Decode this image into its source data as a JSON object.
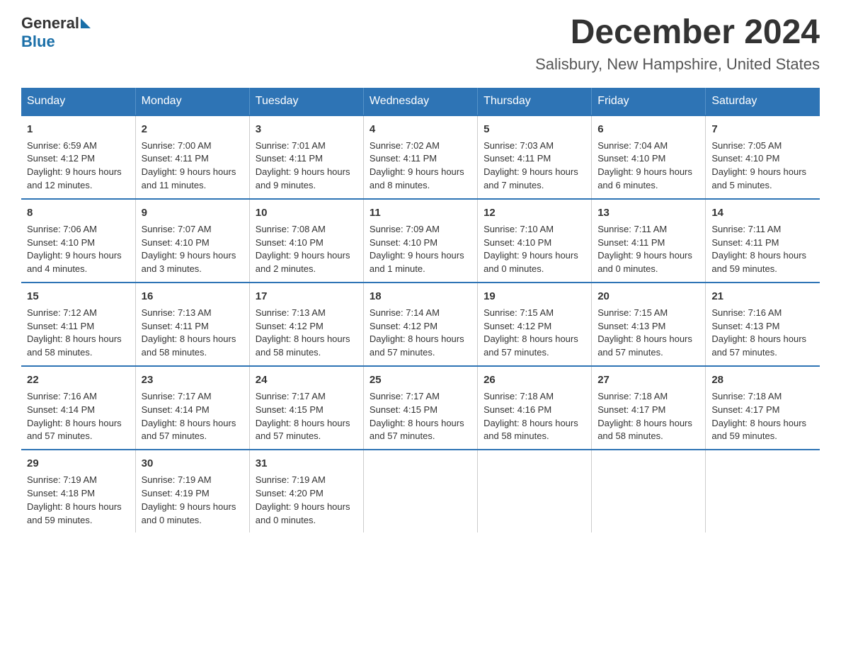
{
  "logo": {
    "general": "General",
    "blue": "Blue"
  },
  "title": "December 2024",
  "subtitle": "Salisbury, New Hampshire, United States",
  "weekdays": [
    "Sunday",
    "Monday",
    "Tuesday",
    "Wednesday",
    "Thursday",
    "Friday",
    "Saturday"
  ],
  "weeks": [
    [
      {
        "day": "1",
        "sunrise": "6:59 AM",
        "sunset": "4:12 PM",
        "daylight": "9 hours and 12 minutes."
      },
      {
        "day": "2",
        "sunrise": "7:00 AM",
        "sunset": "4:11 PM",
        "daylight": "9 hours and 11 minutes."
      },
      {
        "day": "3",
        "sunrise": "7:01 AM",
        "sunset": "4:11 PM",
        "daylight": "9 hours and 9 minutes."
      },
      {
        "day": "4",
        "sunrise": "7:02 AM",
        "sunset": "4:11 PM",
        "daylight": "9 hours and 8 minutes."
      },
      {
        "day": "5",
        "sunrise": "7:03 AM",
        "sunset": "4:11 PM",
        "daylight": "9 hours and 7 minutes."
      },
      {
        "day": "6",
        "sunrise": "7:04 AM",
        "sunset": "4:10 PM",
        "daylight": "9 hours and 6 minutes."
      },
      {
        "day": "7",
        "sunrise": "7:05 AM",
        "sunset": "4:10 PM",
        "daylight": "9 hours and 5 minutes."
      }
    ],
    [
      {
        "day": "8",
        "sunrise": "7:06 AM",
        "sunset": "4:10 PM",
        "daylight": "9 hours and 4 minutes."
      },
      {
        "day": "9",
        "sunrise": "7:07 AM",
        "sunset": "4:10 PM",
        "daylight": "9 hours and 3 minutes."
      },
      {
        "day": "10",
        "sunrise": "7:08 AM",
        "sunset": "4:10 PM",
        "daylight": "9 hours and 2 minutes."
      },
      {
        "day": "11",
        "sunrise": "7:09 AM",
        "sunset": "4:10 PM",
        "daylight": "9 hours and 1 minute."
      },
      {
        "day": "12",
        "sunrise": "7:10 AM",
        "sunset": "4:10 PM",
        "daylight": "9 hours and 0 minutes."
      },
      {
        "day": "13",
        "sunrise": "7:11 AM",
        "sunset": "4:11 PM",
        "daylight": "9 hours and 0 minutes."
      },
      {
        "day": "14",
        "sunrise": "7:11 AM",
        "sunset": "4:11 PM",
        "daylight": "8 hours and 59 minutes."
      }
    ],
    [
      {
        "day": "15",
        "sunrise": "7:12 AM",
        "sunset": "4:11 PM",
        "daylight": "8 hours and 58 minutes."
      },
      {
        "day": "16",
        "sunrise": "7:13 AM",
        "sunset": "4:11 PM",
        "daylight": "8 hours and 58 minutes."
      },
      {
        "day": "17",
        "sunrise": "7:13 AM",
        "sunset": "4:12 PM",
        "daylight": "8 hours and 58 minutes."
      },
      {
        "day": "18",
        "sunrise": "7:14 AM",
        "sunset": "4:12 PM",
        "daylight": "8 hours and 57 minutes."
      },
      {
        "day": "19",
        "sunrise": "7:15 AM",
        "sunset": "4:12 PM",
        "daylight": "8 hours and 57 minutes."
      },
      {
        "day": "20",
        "sunrise": "7:15 AM",
        "sunset": "4:13 PM",
        "daylight": "8 hours and 57 minutes."
      },
      {
        "day": "21",
        "sunrise": "7:16 AM",
        "sunset": "4:13 PM",
        "daylight": "8 hours and 57 minutes."
      }
    ],
    [
      {
        "day": "22",
        "sunrise": "7:16 AM",
        "sunset": "4:14 PM",
        "daylight": "8 hours and 57 minutes."
      },
      {
        "day": "23",
        "sunrise": "7:17 AM",
        "sunset": "4:14 PM",
        "daylight": "8 hours and 57 minutes."
      },
      {
        "day": "24",
        "sunrise": "7:17 AM",
        "sunset": "4:15 PM",
        "daylight": "8 hours and 57 minutes."
      },
      {
        "day": "25",
        "sunrise": "7:17 AM",
        "sunset": "4:15 PM",
        "daylight": "8 hours and 57 minutes."
      },
      {
        "day": "26",
        "sunrise": "7:18 AM",
        "sunset": "4:16 PM",
        "daylight": "8 hours and 58 minutes."
      },
      {
        "day": "27",
        "sunrise": "7:18 AM",
        "sunset": "4:17 PM",
        "daylight": "8 hours and 58 minutes."
      },
      {
        "day": "28",
        "sunrise": "7:18 AM",
        "sunset": "4:17 PM",
        "daylight": "8 hours and 59 minutes."
      }
    ],
    [
      {
        "day": "29",
        "sunrise": "7:19 AM",
        "sunset": "4:18 PM",
        "daylight": "8 hours and 59 minutes."
      },
      {
        "day": "30",
        "sunrise": "7:19 AM",
        "sunset": "4:19 PM",
        "daylight": "9 hours and 0 minutes."
      },
      {
        "day": "31",
        "sunrise": "7:19 AM",
        "sunset": "4:20 PM",
        "daylight": "9 hours and 0 minutes."
      },
      null,
      null,
      null,
      null
    ]
  ],
  "labels": {
    "sunrise": "Sunrise:",
    "sunset": "Sunset:",
    "daylight": "Daylight:"
  }
}
